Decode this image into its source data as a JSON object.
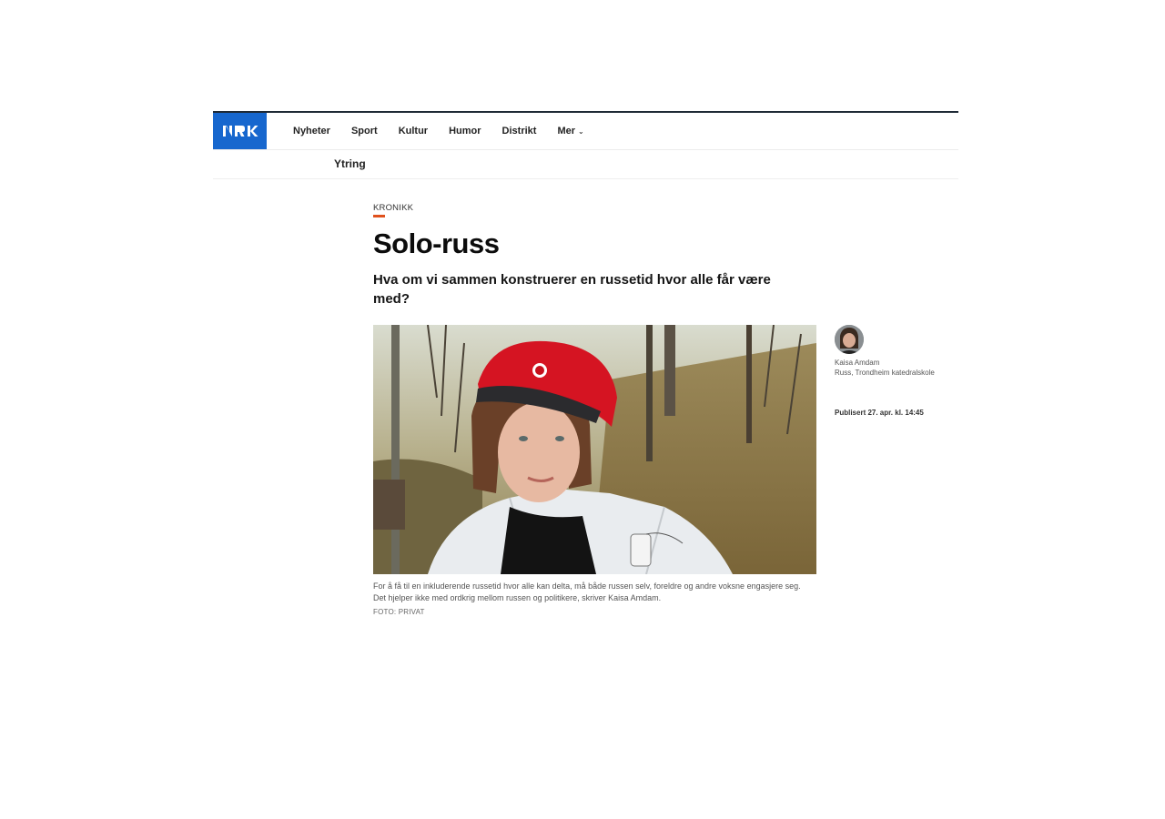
{
  "brand": {
    "logo_text": "NRK",
    "logo_color": "#1767ce"
  },
  "nav": {
    "items": [
      {
        "label": "Nyheter"
      },
      {
        "label": "Sport"
      },
      {
        "label": "Kultur"
      },
      {
        "label": "Humor"
      },
      {
        "label": "Distrikt"
      },
      {
        "label": "Mer"
      }
    ]
  },
  "subnav": {
    "section": "Ytring"
  },
  "article": {
    "kicker": "KRONIKK",
    "kicker_color": "#e0511d",
    "title": "Solo-russ",
    "lead": "Hva om vi sammen konstruerer en russetid hvor alle får være med?",
    "caption": "For å få til en inkluderende russetid hvor alle kan delta, må både russen selv, foreldre og andre voksne engasjere seg. Det hjelper ikke med ordkrig mellom russen og politikere, skriver Kaisa Amdam.",
    "photo_credit": "FOTO: PRIVAT"
  },
  "author": {
    "name": "Kaisa Amdam",
    "role": "Russ, Trondheim katedralskole"
  },
  "published": "Publisert 27. apr. kl. 14:45"
}
